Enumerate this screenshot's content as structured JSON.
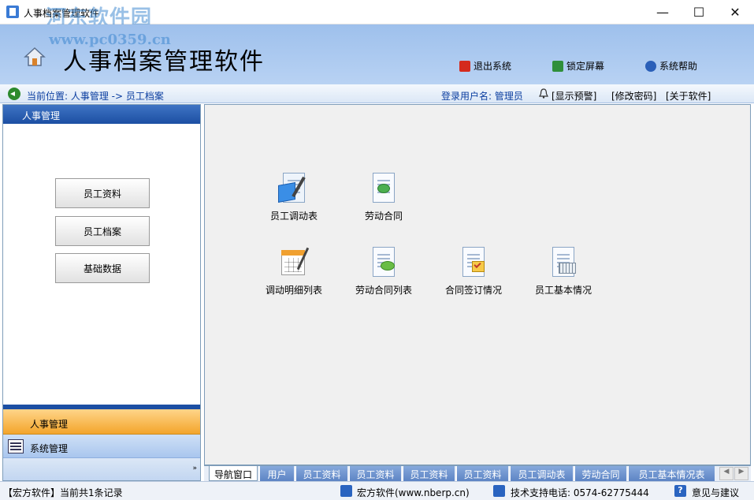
{
  "window": {
    "title": "人事档案管理软件",
    "watermark": "河东软件园",
    "watermark_url": "www.pc0359.cn",
    "min_glyph": "—",
    "max_glyph": "☐",
    "close_glyph": "✕"
  },
  "header": {
    "app_title": "人事档案管理软件",
    "buttons": {
      "exit": "退出系统",
      "lock": "锁定屏幕",
      "help": "系统帮助"
    }
  },
  "breadcrumb": {
    "text": "当前位置: 人事管理 -> 员工档案",
    "login": "登录用户名: 管理员",
    "links": {
      "warning": "[显示预警]",
      "password": "[修改密码]",
      "about": "[关于软件]"
    }
  },
  "sidebar": {
    "header": "人事管理",
    "buttons": [
      "员工资料",
      "员工档案",
      "基础数据"
    ],
    "groups": {
      "hr": "人事管理",
      "system": "系统管理",
      "more": "»"
    }
  },
  "main": {
    "items": [
      {
        "label": "员工调动表",
        "icon": "transfer-form-icon"
      },
      {
        "label": "劳动合同",
        "icon": "labor-contract-icon"
      },
      {
        "label": "调动明细列表",
        "icon": "transfer-detail-list-icon"
      },
      {
        "label": "劳动合同列表",
        "icon": "contract-list-icon"
      },
      {
        "label": "合同签订情况",
        "icon": "contract-signing-icon"
      },
      {
        "label": "员工基本情况",
        "icon": "employee-info-icon"
      }
    ]
  },
  "tabs": [
    "导航窗口",
    "用户",
    "员工资料",
    "员工资料",
    "员工资料",
    "员工资料",
    "员工调动表",
    "劳动合同",
    "员工基本情况表"
  ],
  "status": {
    "records": "【宏方软件】当前共1条记录",
    "company": "宏方软件(www.nberp.cn)",
    "support": "技术支持电话: 0574-62775444",
    "feedback": "意见与建议",
    "help_glyph": "?"
  },
  "colors": {
    "banner": "#b8d2f3",
    "active_group": "#f3a52b",
    "sidebar_header": "#1c4fa3",
    "tab": "#5d84c4"
  }
}
